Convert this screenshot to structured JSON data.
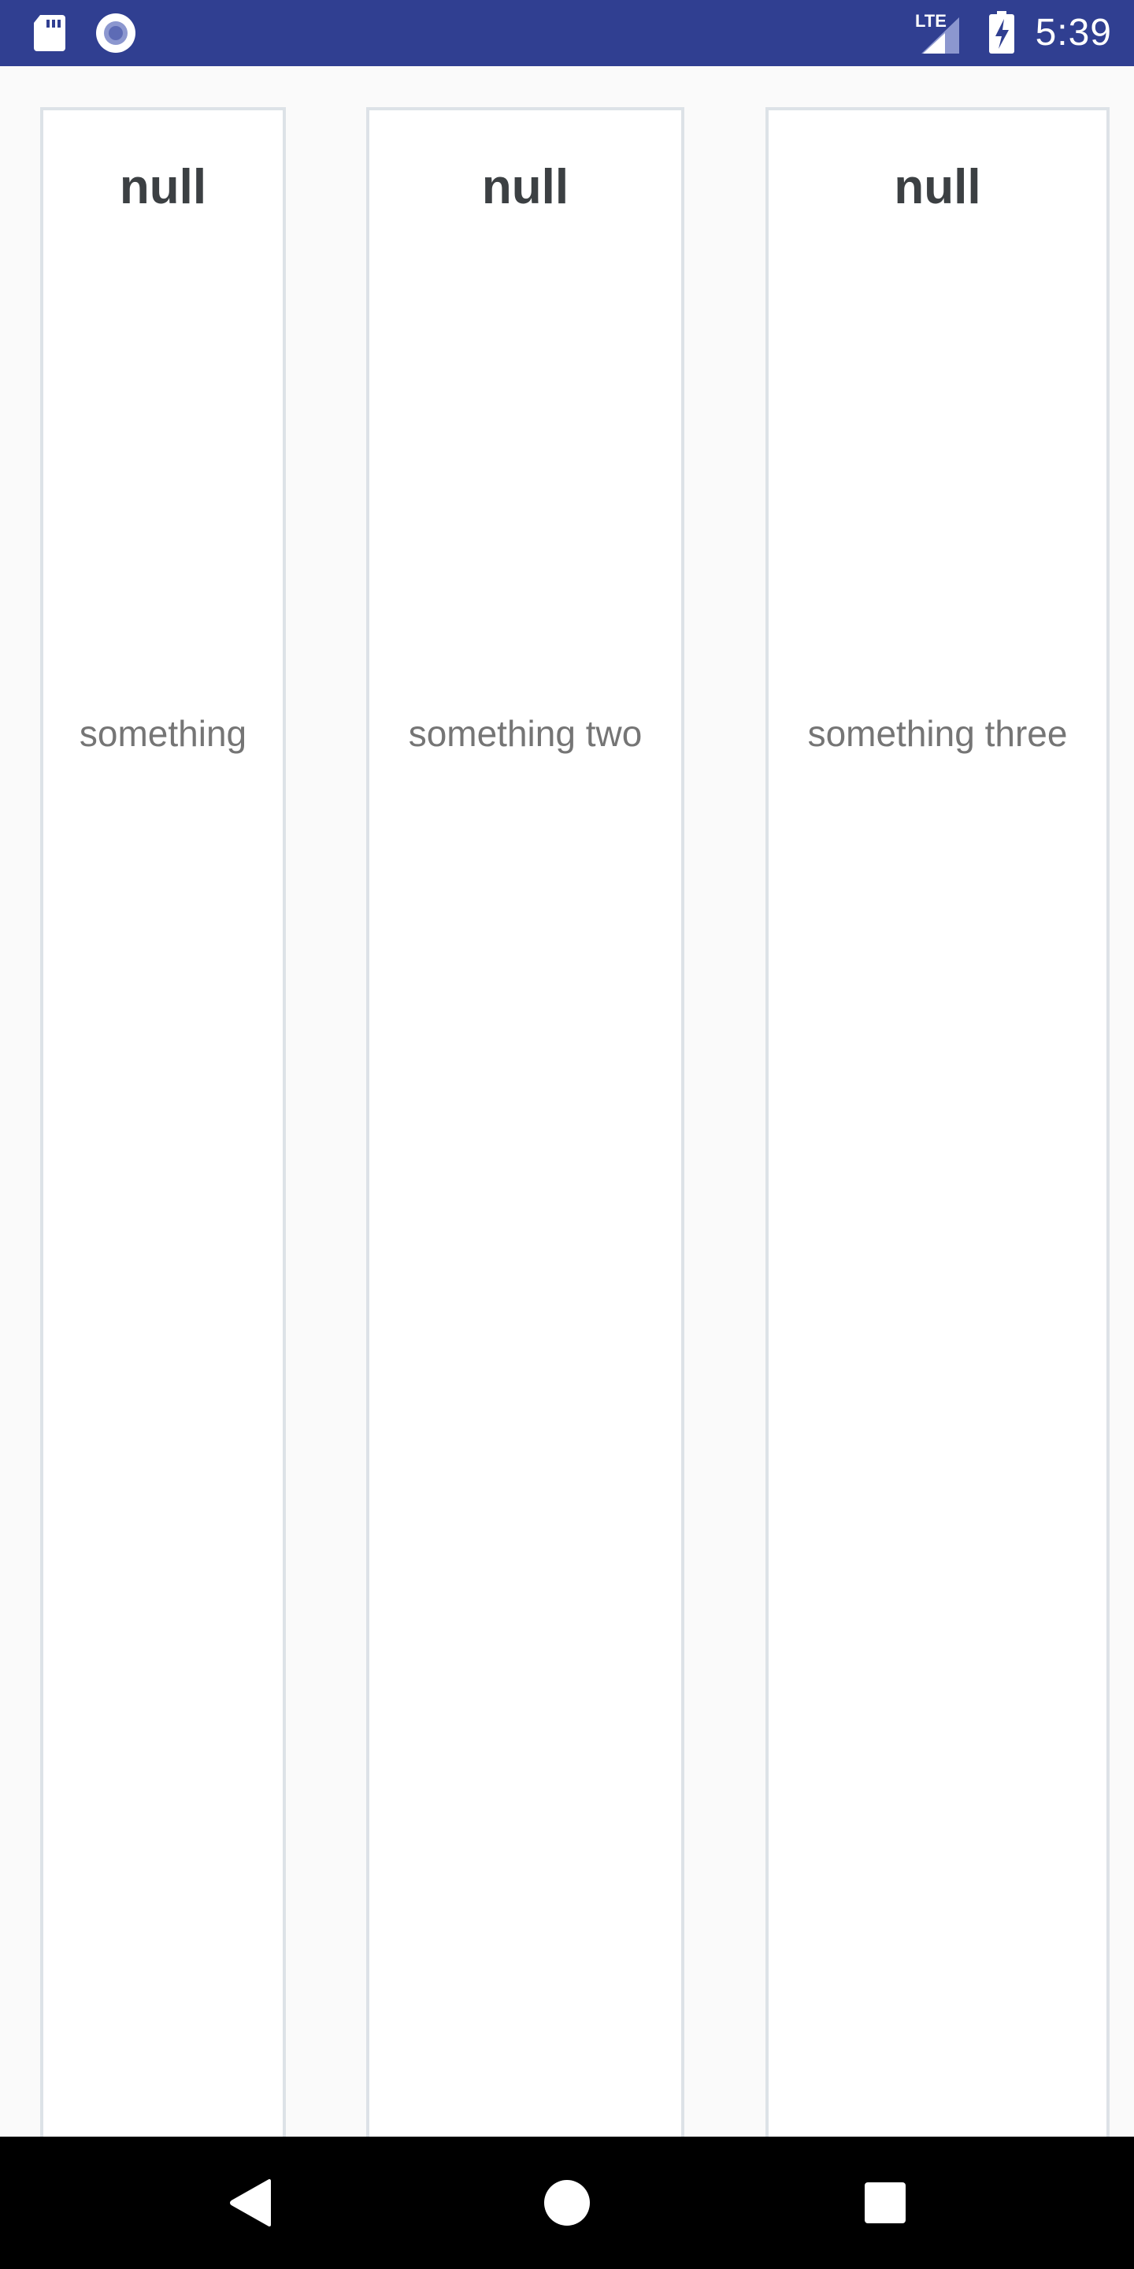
{
  "status_bar": {
    "time": "5:39",
    "network_label": "LTE",
    "icons": [
      "sd-card-icon",
      "sync-icon",
      "lte-signal-icon",
      "battery-charging-icon"
    ],
    "background_color": "#303f91"
  },
  "cards": [
    {
      "title": "null",
      "text": "something"
    },
    {
      "title": "null",
      "text": "something two"
    },
    {
      "title": "null",
      "text": "something three"
    }
  ],
  "nav_bar": {
    "icons": [
      "back-icon",
      "home-icon",
      "recents-icon"
    ],
    "background_color": "#000000"
  }
}
